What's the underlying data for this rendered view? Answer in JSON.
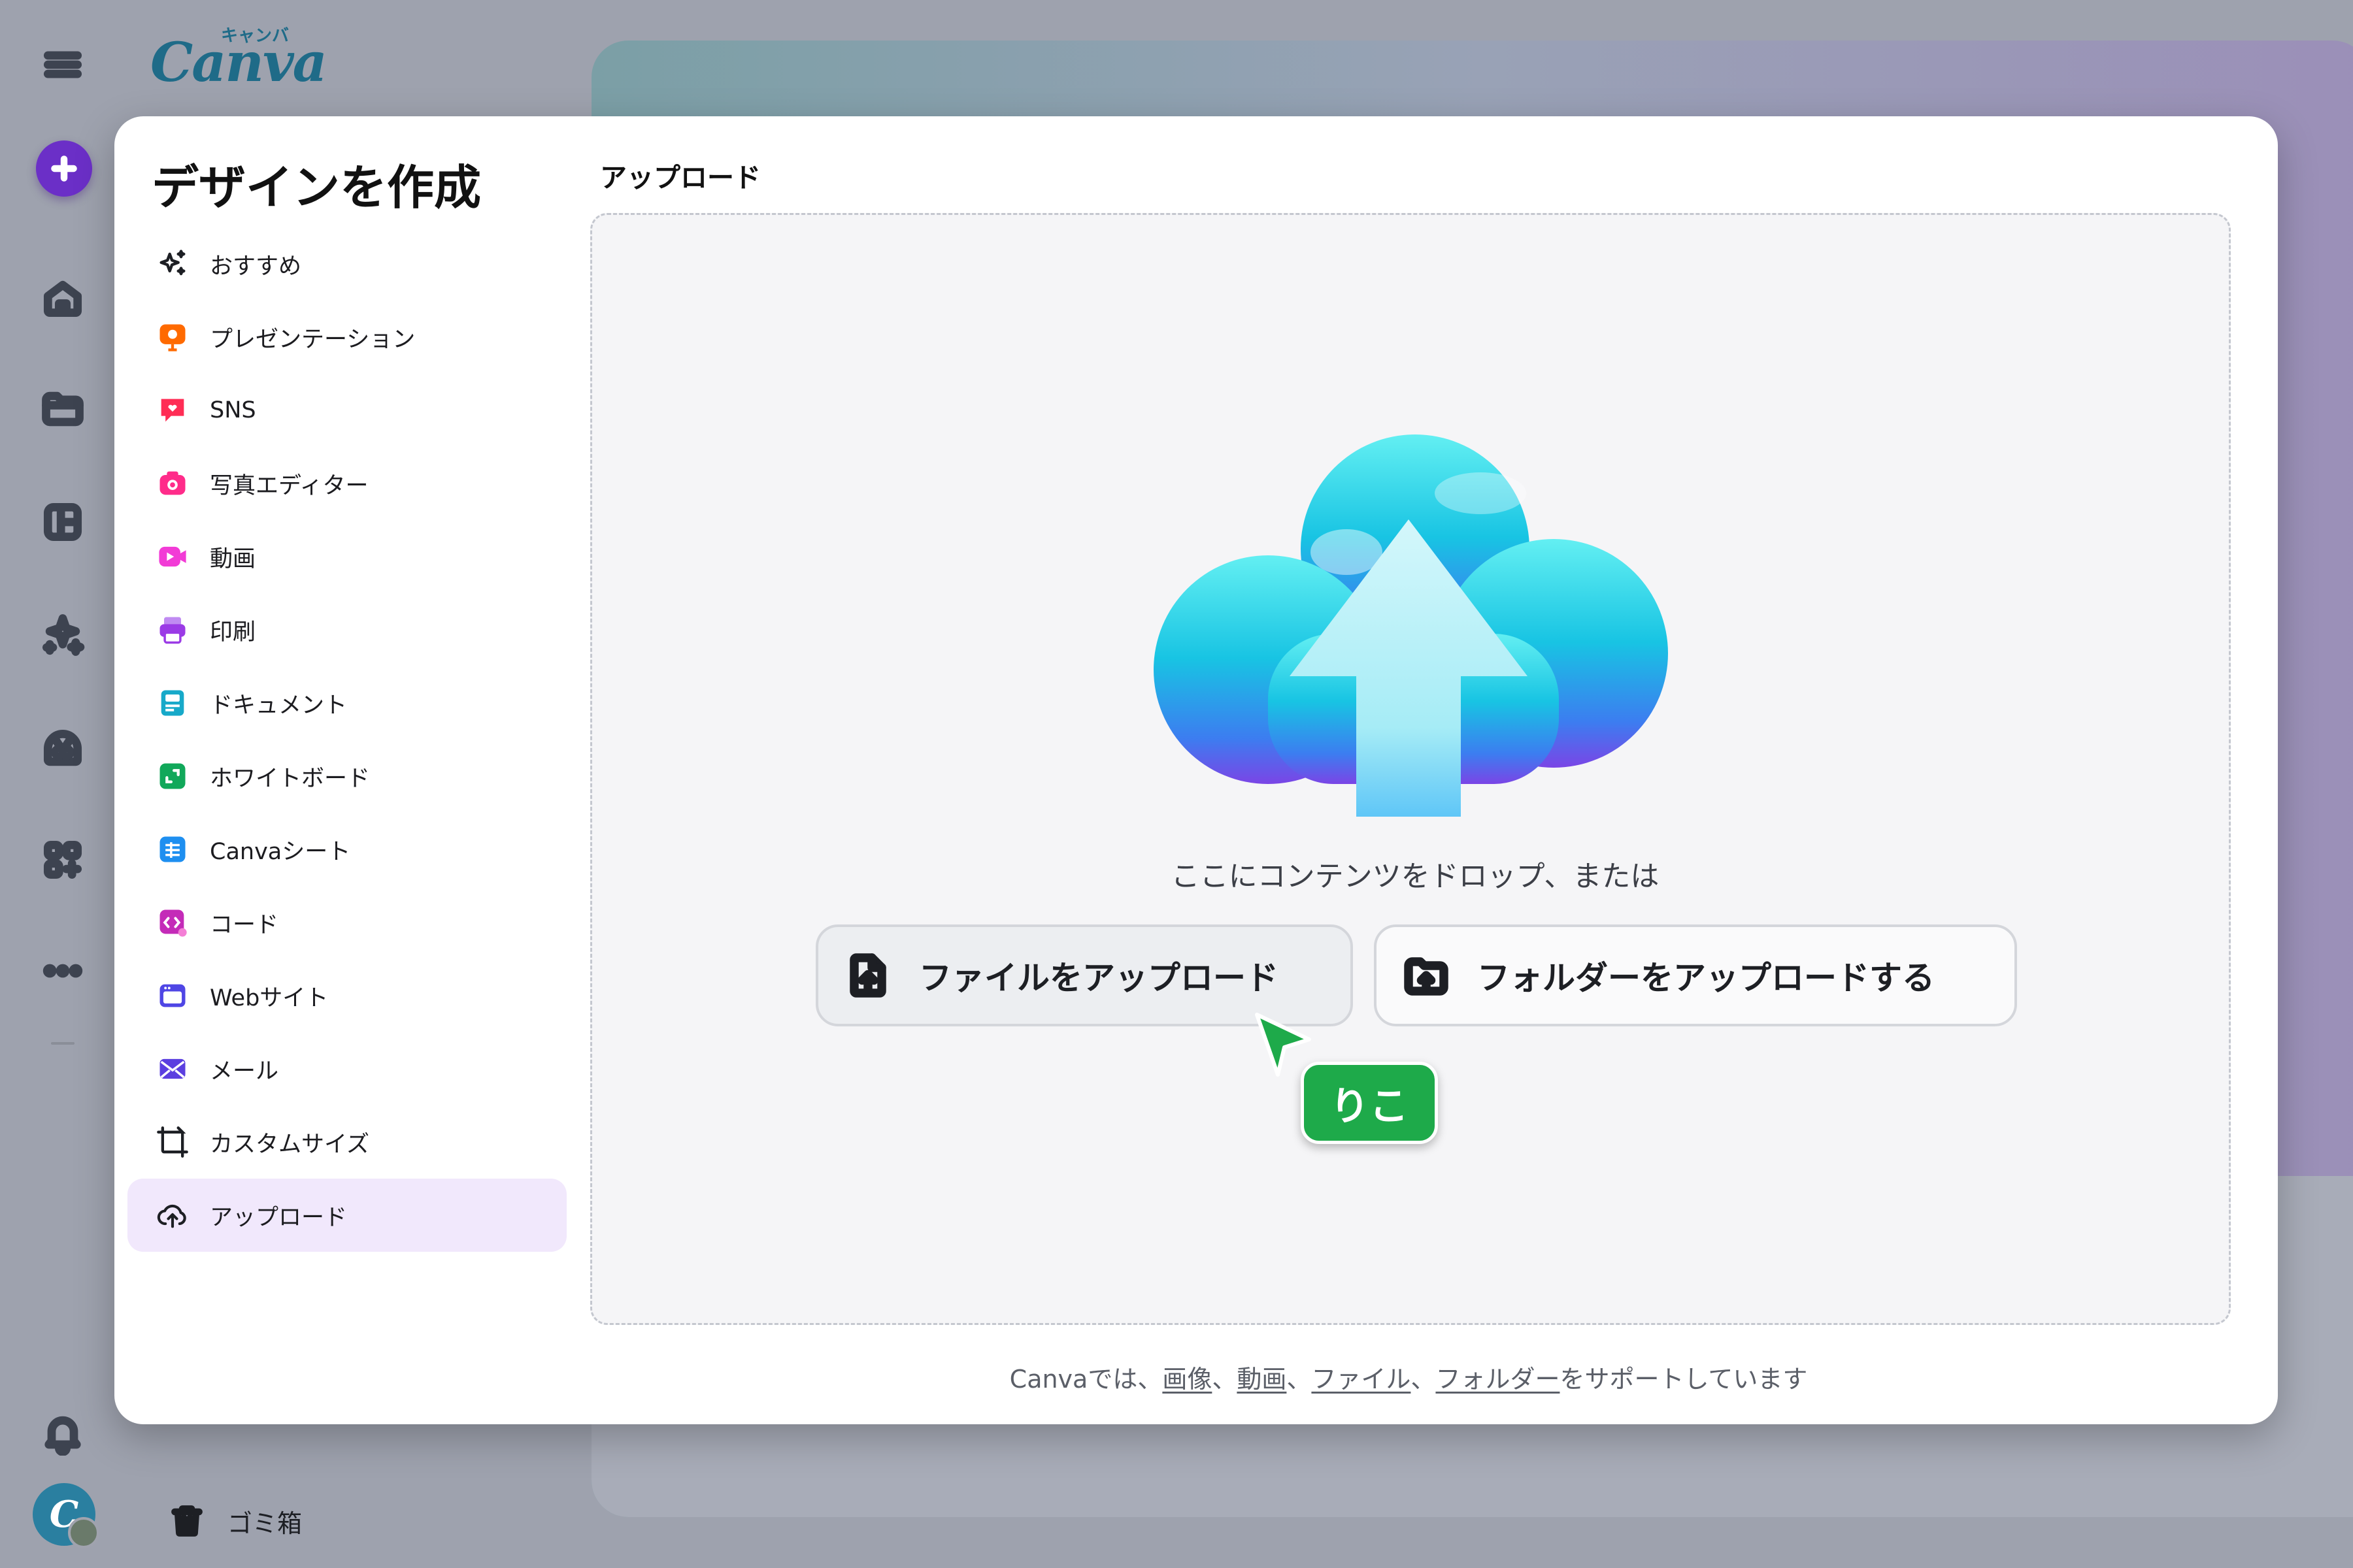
{
  "app": {
    "logo_word": "Canva",
    "logo_kana": "キャンバ",
    "trash_label": "ゴミ箱"
  },
  "rail_icons": [
    "menu-icon",
    "plus-icon",
    "home-icon",
    "folder-icon",
    "templates-icon",
    "magic-sparkle-icon",
    "brand-kit-icon",
    "apps-icon",
    "more-icon",
    "bell-icon"
  ],
  "modal": {
    "title": "デザインを作成",
    "menu": [
      {
        "label": "おすすめ",
        "icon": "sparkle-icon",
        "color": "#1d1f24"
      },
      {
        "label": "プレゼンテーション",
        "icon": "presentation-icon",
        "color": "#ff6a00"
      },
      {
        "label": "SNS",
        "icon": "heart-chat-icon",
        "color": "#ff2d55"
      },
      {
        "label": "写真エディター",
        "icon": "camera-icon",
        "color": "#ff2c8a"
      },
      {
        "label": "動画",
        "icon": "video-icon",
        "color": "#f23bd6"
      },
      {
        "label": "印刷",
        "icon": "printer-icon",
        "color": "#9b3be6"
      },
      {
        "label": "ドキュメント",
        "icon": "document-icon",
        "color": "#17a9c9"
      },
      {
        "label": "ホワイトボード",
        "icon": "whiteboard-icon",
        "color": "#11a85a"
      },
      {
        "label": "Canvaシート",
        "icon": "sheet-icon",
        "color": "#1e8ff0"
      },
      {
        "label": "コード",
        "icon": "code-icon",
        "color": "#c42bb8"
      },
      {
        "label": "Webサイト",
        "icon": "website-icon",
        "color": "#4f46e5"
      },
      {
        "label": "メール",
        "icon": "mail-icon",
        "color": "#5b3fe0"
      },
      {
        "label": "カスタムサイズ",
        "icon": "custom-size-icon",
        "color": "#1d1f24"
      },
      {
        "label": "アップロード",
        "icon": "cloud-upload-icon",
        "color": "#1d1f24",
        "active": true
      }
    ],
    "content_title": "アップロード",
    "drop_text": "ここにコンテンツをドロップ、または",
    "upload_file_label": "ファイルをアップロード",
    "upload_folder_label": "フォルダーをアップロードする",
    "cursor_name": "りこ",
    "support": {
      "prefix": "Canvaでは、",
      "images": "画像",
      "sep1": "、",
      "videos": "動画",
      "sep2": "、",
      "files": "ファイル",
      "sep3": "、",
      "folders": "フォルダー",
      "suffix": "をサポートしています"
    }
  },
  "colors": {
    "accent": "#6b2fc7",
    "active_bg": "#f1e8fc",
    "cursor_green": "#1eaa4a"
  }
}
